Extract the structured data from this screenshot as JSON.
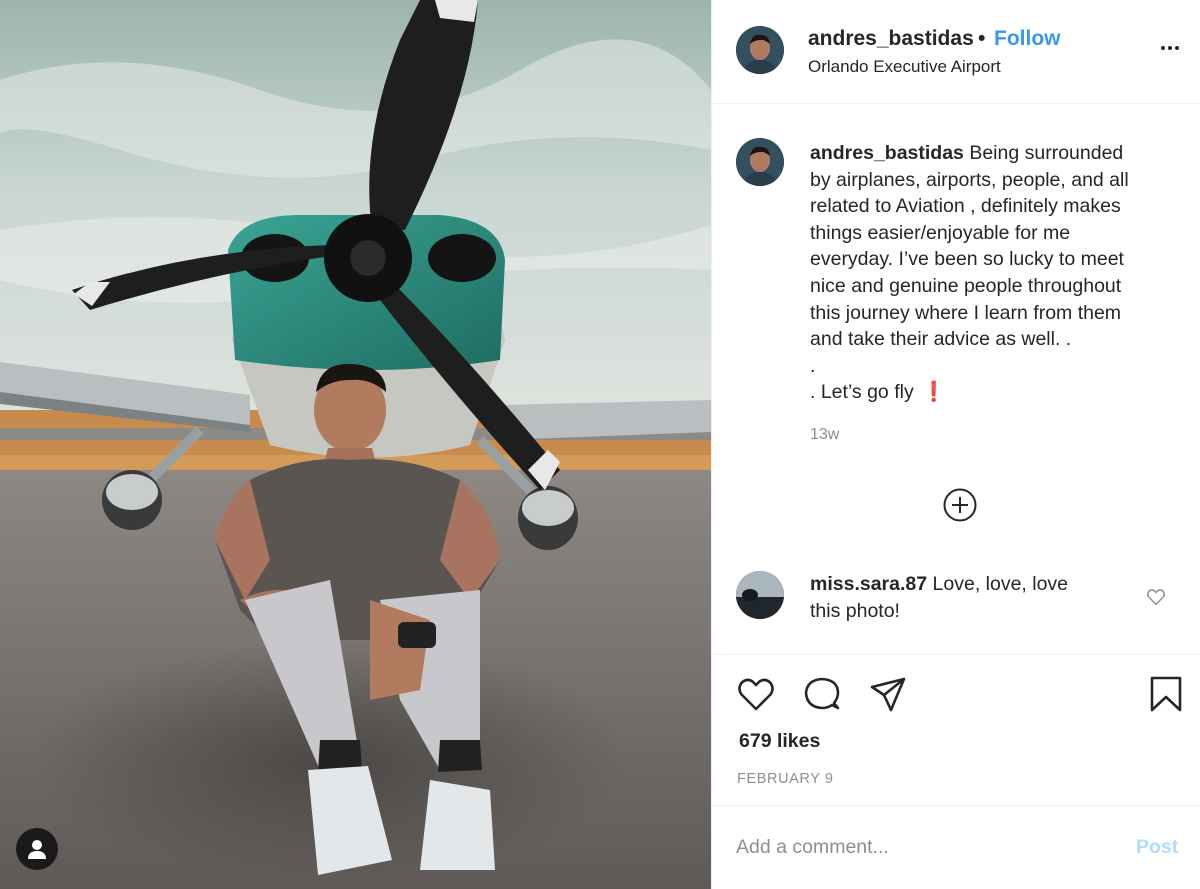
{
  "post": {
    "username": "andres_bastidas",
    "separator": "•",
    "follow_label": "Follow",
    "location": "Orlando Executive Airport",
    "caption_lines": [
      "Being surrounded",
      "by airplanes, airports, people, and all",
      "related to Aviation , definitely makes",
      "things easier/enjoyable for me",
      "everyday. I’ve been so lucky to meet",
      "nice and genuine people throughout",
      "this journey where I learn from them",
      "and take their advice as well. .",
      ".",
      ". Let’s go fly"
    ],
    "caption_emoji": "❗",
    "time_ago": "13w",
    "likes": "679 likes",
    "date": "FEBRUARY 9"
  },
  "comments": [
    {
      "username": "miss.sara.87",
      "text": "Love, love, love",
      "text_line2": "this photo!"
    }
  ],
  "comment_box": {
    "placeholder": "Add a comment...",
    "post_label": "Post"
  },
  "icons": {
    "more": "more-options-icon",
    "load_more": "plus-circle-icon",
    "like": "heart-icon",
    "comment": "comment-bubble-icon",
    "share": "paper-plane-icon",
    "save": "bookmark-icon",
    "tag": "user-tag-icon"
  },
  "colors": {
    "link_blue": "#3897f0",
    "post_disabled": "#b3dbff",
    "muted": "#8e8e8e"
  }
}
